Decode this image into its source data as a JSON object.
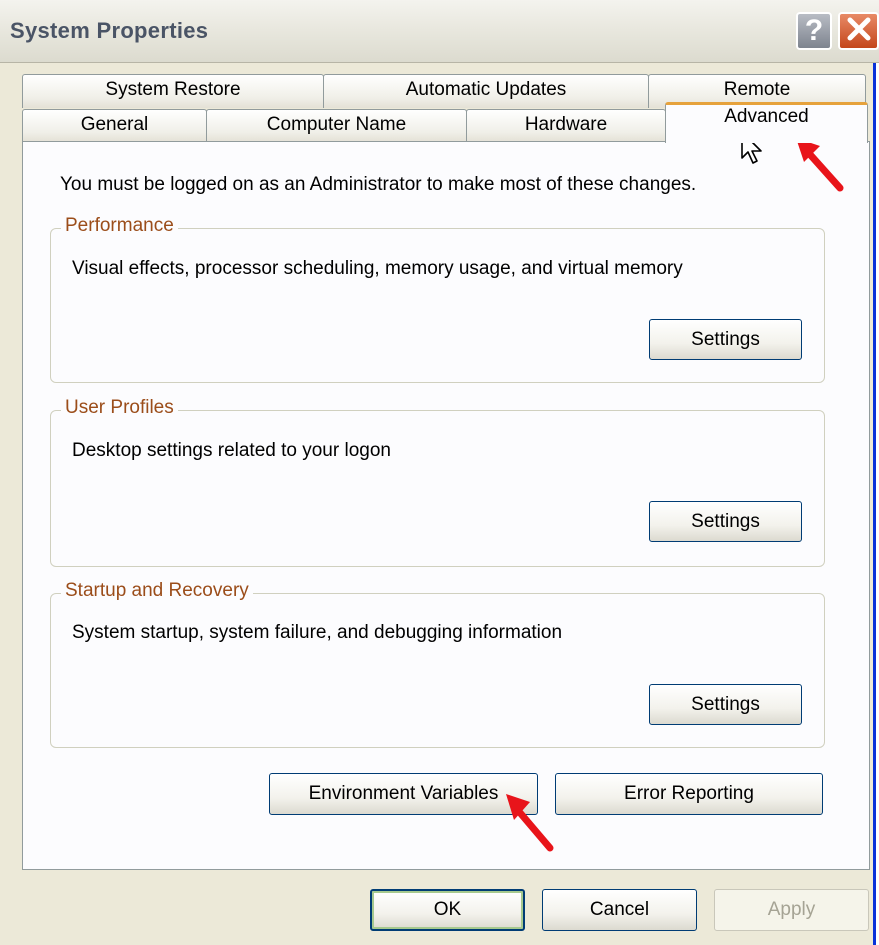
{
  "window": {
    "title": "System Properties",
    "help_label": "?",
    "close_label": "✕"
  },
  "tabs": {
    "row1": [
      "System Restore",
      "Automatic Updates",
      "Remote"
    ],
    "row2": [
      "General",
      "Computer Name",
      "Hardware",
      "Advanced"
    ],
    "active": "Advanced"
  },
  "panel": {
    "info": "You must be logged on as an Administrator to make most of these changes.",
    "groups": [
      {
        "title": "Performance",
        "description": "Visual effects, processor scheduling, memory usage, and virtual memory",
        "button": "Settings"
      },
      {
        "title": "User Profiles",
        "description": "Desktop settings related to your logon",
        "button": "Settings"
      },
      {
        "title": "Startup and Recovery",
        "description": "System startup, system failure, and debugging information",
        "button": "Settings"
      }
    ],
    "env_button": "Environment Variables",
    "error_button": "Error Reporting"
  },
  "footer": {
    "ok": "OK",
    "cancel": "Cancel",
    "apply": "Apply"
  },
  "icons": [
    "help-icon",
    "close-icon",
    "mouse-cursor-icon",
    "red-arrow-annotation"
  ],
  "colors": {
    "tab_highlight": "#e6a23c",
    "group_title": "#9b4d1a",
    "annotation_arrow": "#e8141a",
    "close_button": "#c4461b"
  }
}
